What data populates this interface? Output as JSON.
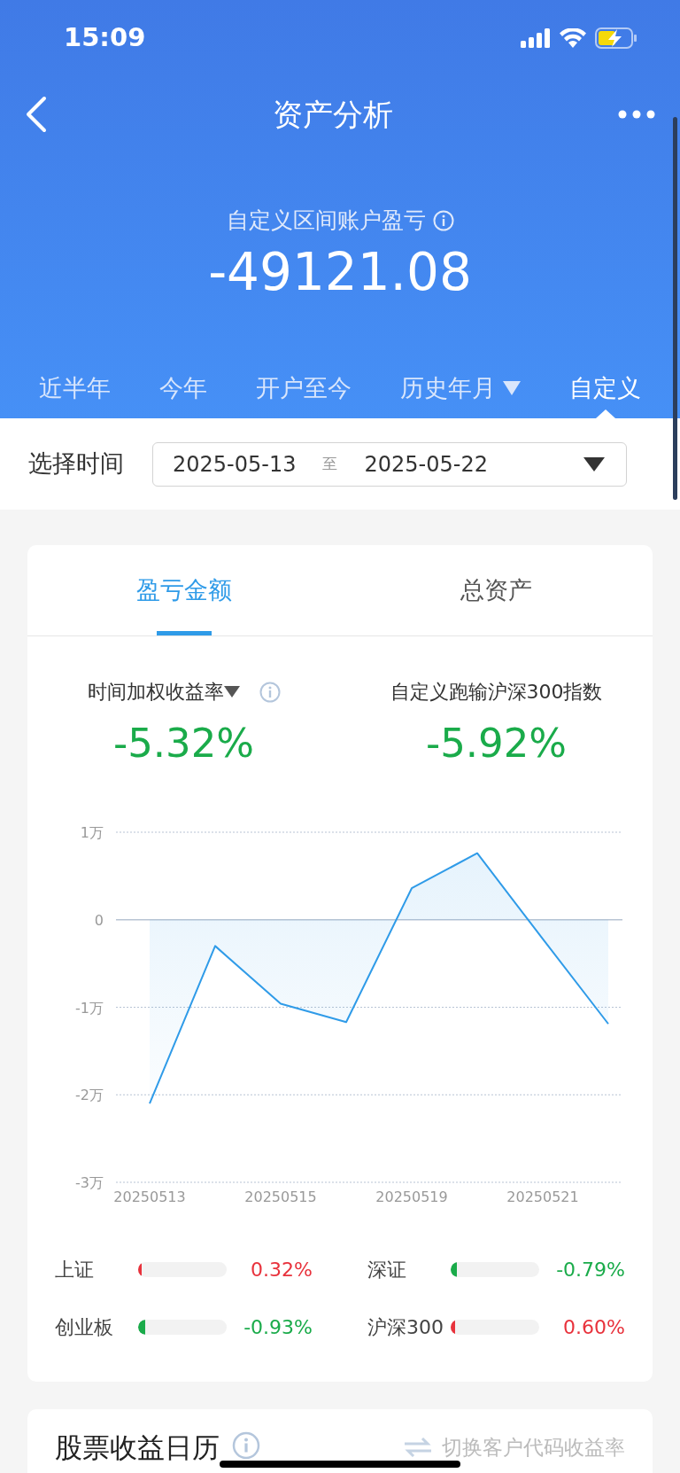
{
  "status_bar": {
    "time": "15:09"
  },
  "header": {
    "title": "资产分析",
    "summary_label": "自定义区间账户盈亏",
    "summary_value": "-49121.08"
  },
  "period_tabs": [
    {
      "label": "近半年",
      "selected": false,
      "dropdown": false
    },
    {
      "label": "今年",
      "selected": false,
      "dropdown": false
    },
    {
      "label": "开户至今",
      "selected": false,
      "dropdown": false
    },
    {
      "label": "历史年月",
      "selected": false,
      "dropdown": true
    },
    {
      "label": "自定义",
      "selected": true,
      "dropdown": false
    }
  ],
  "date_range": {
    "label": "选择时间",
    "start": "2025-05-13",
    "separator": "至",
    "end": "2025-05-22"
  },
  "chart_tabs": [
    {
      "label": "盈亏金额",
      "selected": true
    },
    {
      "label": "总资产",
      "selected": false
    }
  ],
  "metrics": [
    {
      "label": "时间加权收益率",
      "dropdown": true,
      "info": true,
      "value": "-5.32%"
    },
    {
      "label": "自定义跑输沪深300指数",
      "dropdown": false,
      "info": false,
      "value": "-5.92%"
    }
  ],
  "chart_data": {
    "type": "area",
    "categories": [
      "20250513",
      null,
      "20250515",
      null,
      "20250519",
      null,
      "20250521",
      null
    ],
    "series": [
      {
        "color": "#2f9be8",
        "values": [
          -2.1,
          -0.3,
          -0.96,
          -1.17,
          0.36,
          0.76,
          -0.22,
          -1.19
        ]
      }
    ],
    "ylim": [
      -3,
      1
    ],
    "grid": true,
    "yticks": [
      {
        "value": 1,
        "label": "1万"
      },
      {
        "value": 0,
        "label": "0"
      },
      {
        "value": -1,
        "label": "-1万"
      },
      {
        "value": -2,
        "label": "-2万"
      },
      {
        "value": -3,
        "label": "-3万"
      }
    ]
  },
  "indices": [
    {
      "name": "上证",
      "level": 0.04,
      "color": "#e8323c",
      "value": "0.32%"
    },
    {
      "name": "深证",
      "level": 0.07,
      "color": "#1aab4a",
      "value": "-0.79%"
    },
    {
      "name": "创业板",
      "level": 0.08,
      "color": "#1aab4a",
      "value": "-0.93%"
    },
    {
      "name": "沪深300",
      "level": 0.05,
      "color": "#e8323c",
      "value": "0.60%"
    }
  ],
  "calendar": {
    "title": "股票收益日历",
    "switch_label": "切换客户代码收益率"
  }
}
